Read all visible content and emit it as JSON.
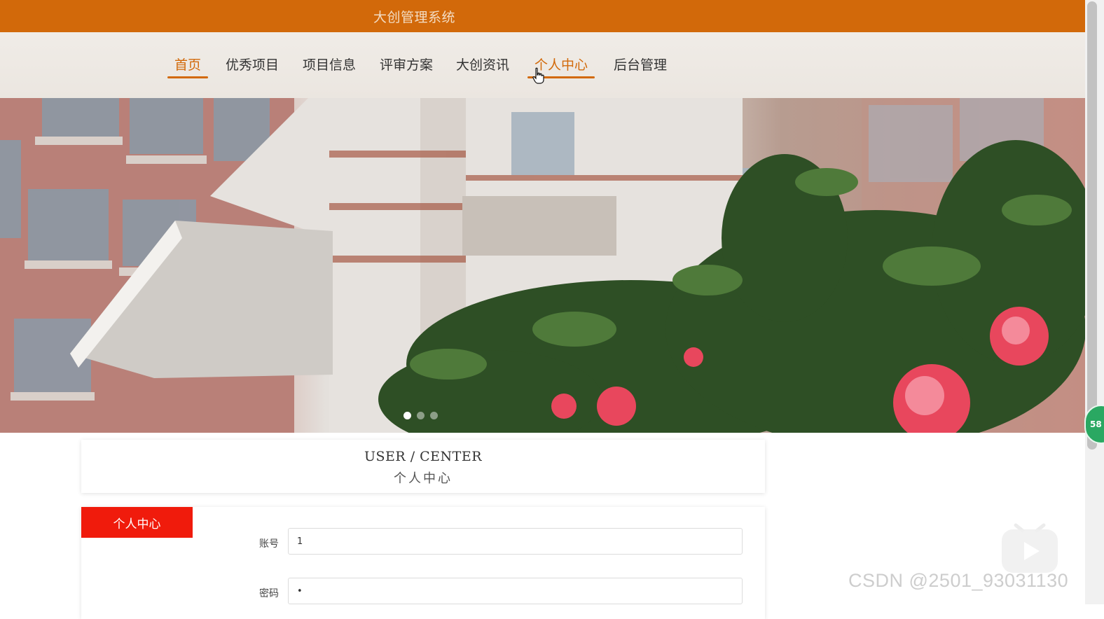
{
  "header": {
    "title": "大创管理系统"
  },
  "nav": {
    "items": [
      {
        "label": "首页",
        "active": true
      },
      {
        "label": "优秀项目",
        "active": false
      },
      {
        "label": "项目信息",
        "active": false
      },
      {
        "label": "评审方案",
        "active": false
      },
      {
        "label": "大创资讯",
        "active": false
      },
      {
        "label": "个人中心",
        "active": false,
        "hovered": true
      },
      {
        "label": "后台管理",
        "active": false
      }
    ]
  },
  "banner": {
    "slide_count": 3,
    "active_slide": 1
  },
  "section": {
    "title_en": "USER / CENTER",
    "title_zh": "个人中心"
  },
  "sidebar": {
    "tab_label": "个人中心"
  },
  "form": {
    "fields": [
      {
        "label": "账号",
        "value": "1"
      },
      {
        "label": "密码",
        "value": "•"
      }
    ]
  },
  "float_badge": {
    "text": "58"
  },
  "watermark": {
    "text": "CSDN @2501_93031130"
  },
  "colors": {
    "accent": "#d2690a",
    "tab_red": "#f01b0c",
    "nav_bg": "#ebe6e0"
  }
}
